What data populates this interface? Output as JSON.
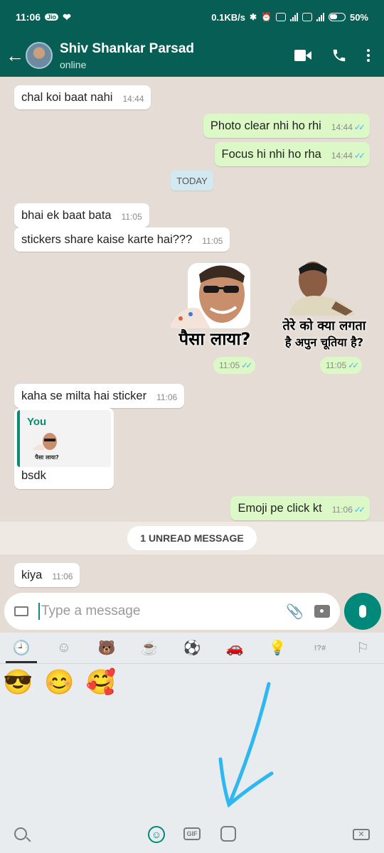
{
  "status_bar": {
    "time": "11:06",
    "speed": "0.1KB/s",
    "battery": "50%"
  },
  "header": {
    "contact_name": "Shiv Shankar Parsad",
    "contact_status": "online"
  },
  "messages": [
    {
      "dir": "in",
      "text": "chal koi baat nahi",
      "time": "14:44"
    },
    {
      "dir": "out",
      "text": "Photo clear nhi ho rhi",
      "time": "14:44"
    },
    {
      "dir": "out",
      "text": "Focus hi nhi ho rha",
      "time": "14:44"
    },
    {
      "dir": "in",
      "text": "bhai ek baat bata",
      "time": "11:05"
    },
    {
      "dir": "in",
      "text": "stickers share kaise karte hai???",
      "time": "11:05"
    },
    {
      "dir": "in",
      "text": "kaha se milta hai sticker",
      "time": "11:06"
    },
    {
      "dir": "in",
      "text": "bsdk",
      "time": "11:06"
    },
    {
      "dir": "out",
      "text": "Emoji pe click kt",
      "time": "11:06"
    },
    {
      "dir": "in",
      "text": "kiya",
      "time": "11:06"
    }
  ],
  "date_divider": "TODAY",
  "stickers": [
    {
      "caption": "पैसा लाया?",
      "time": "11:05"
    },
    {
      "caption_line1": "तेरे को क्या लगता",
      "caption_line2": "है अपुन चूतिया है?",
      "time": "11:05"
    }
  ],
  "reply_quote": {
    "author": "You",
    "thumb_caption": "पैसा लाया?"
  },
  "unread_label": "1 UNREAD MESSAGE",
  "composer": {
    "placeholder": "Type a message"
  },
  "emoji_panel": {
    "categories": [
      "recent-icon",
      "smiley-icon",
      "animal-icon",
      "food-icon",
      "sports-icon",
      "car-icon",
      "bulb-icon",
      "symbols-icon",
      "flag-icon"
    ],
    "recent_emojis": [
      "😎",
      "😊",
      "🥰"
    ],
    "bottom": {
      "gif_label": "GIF"
    }
  },
  "colors": {
    "header": "#075e54",
    "outgoing_bubble": "#dcf8c6",
    "accent": "#00897b",
    "read_ticks": "#4fb5f0"
  }
}
